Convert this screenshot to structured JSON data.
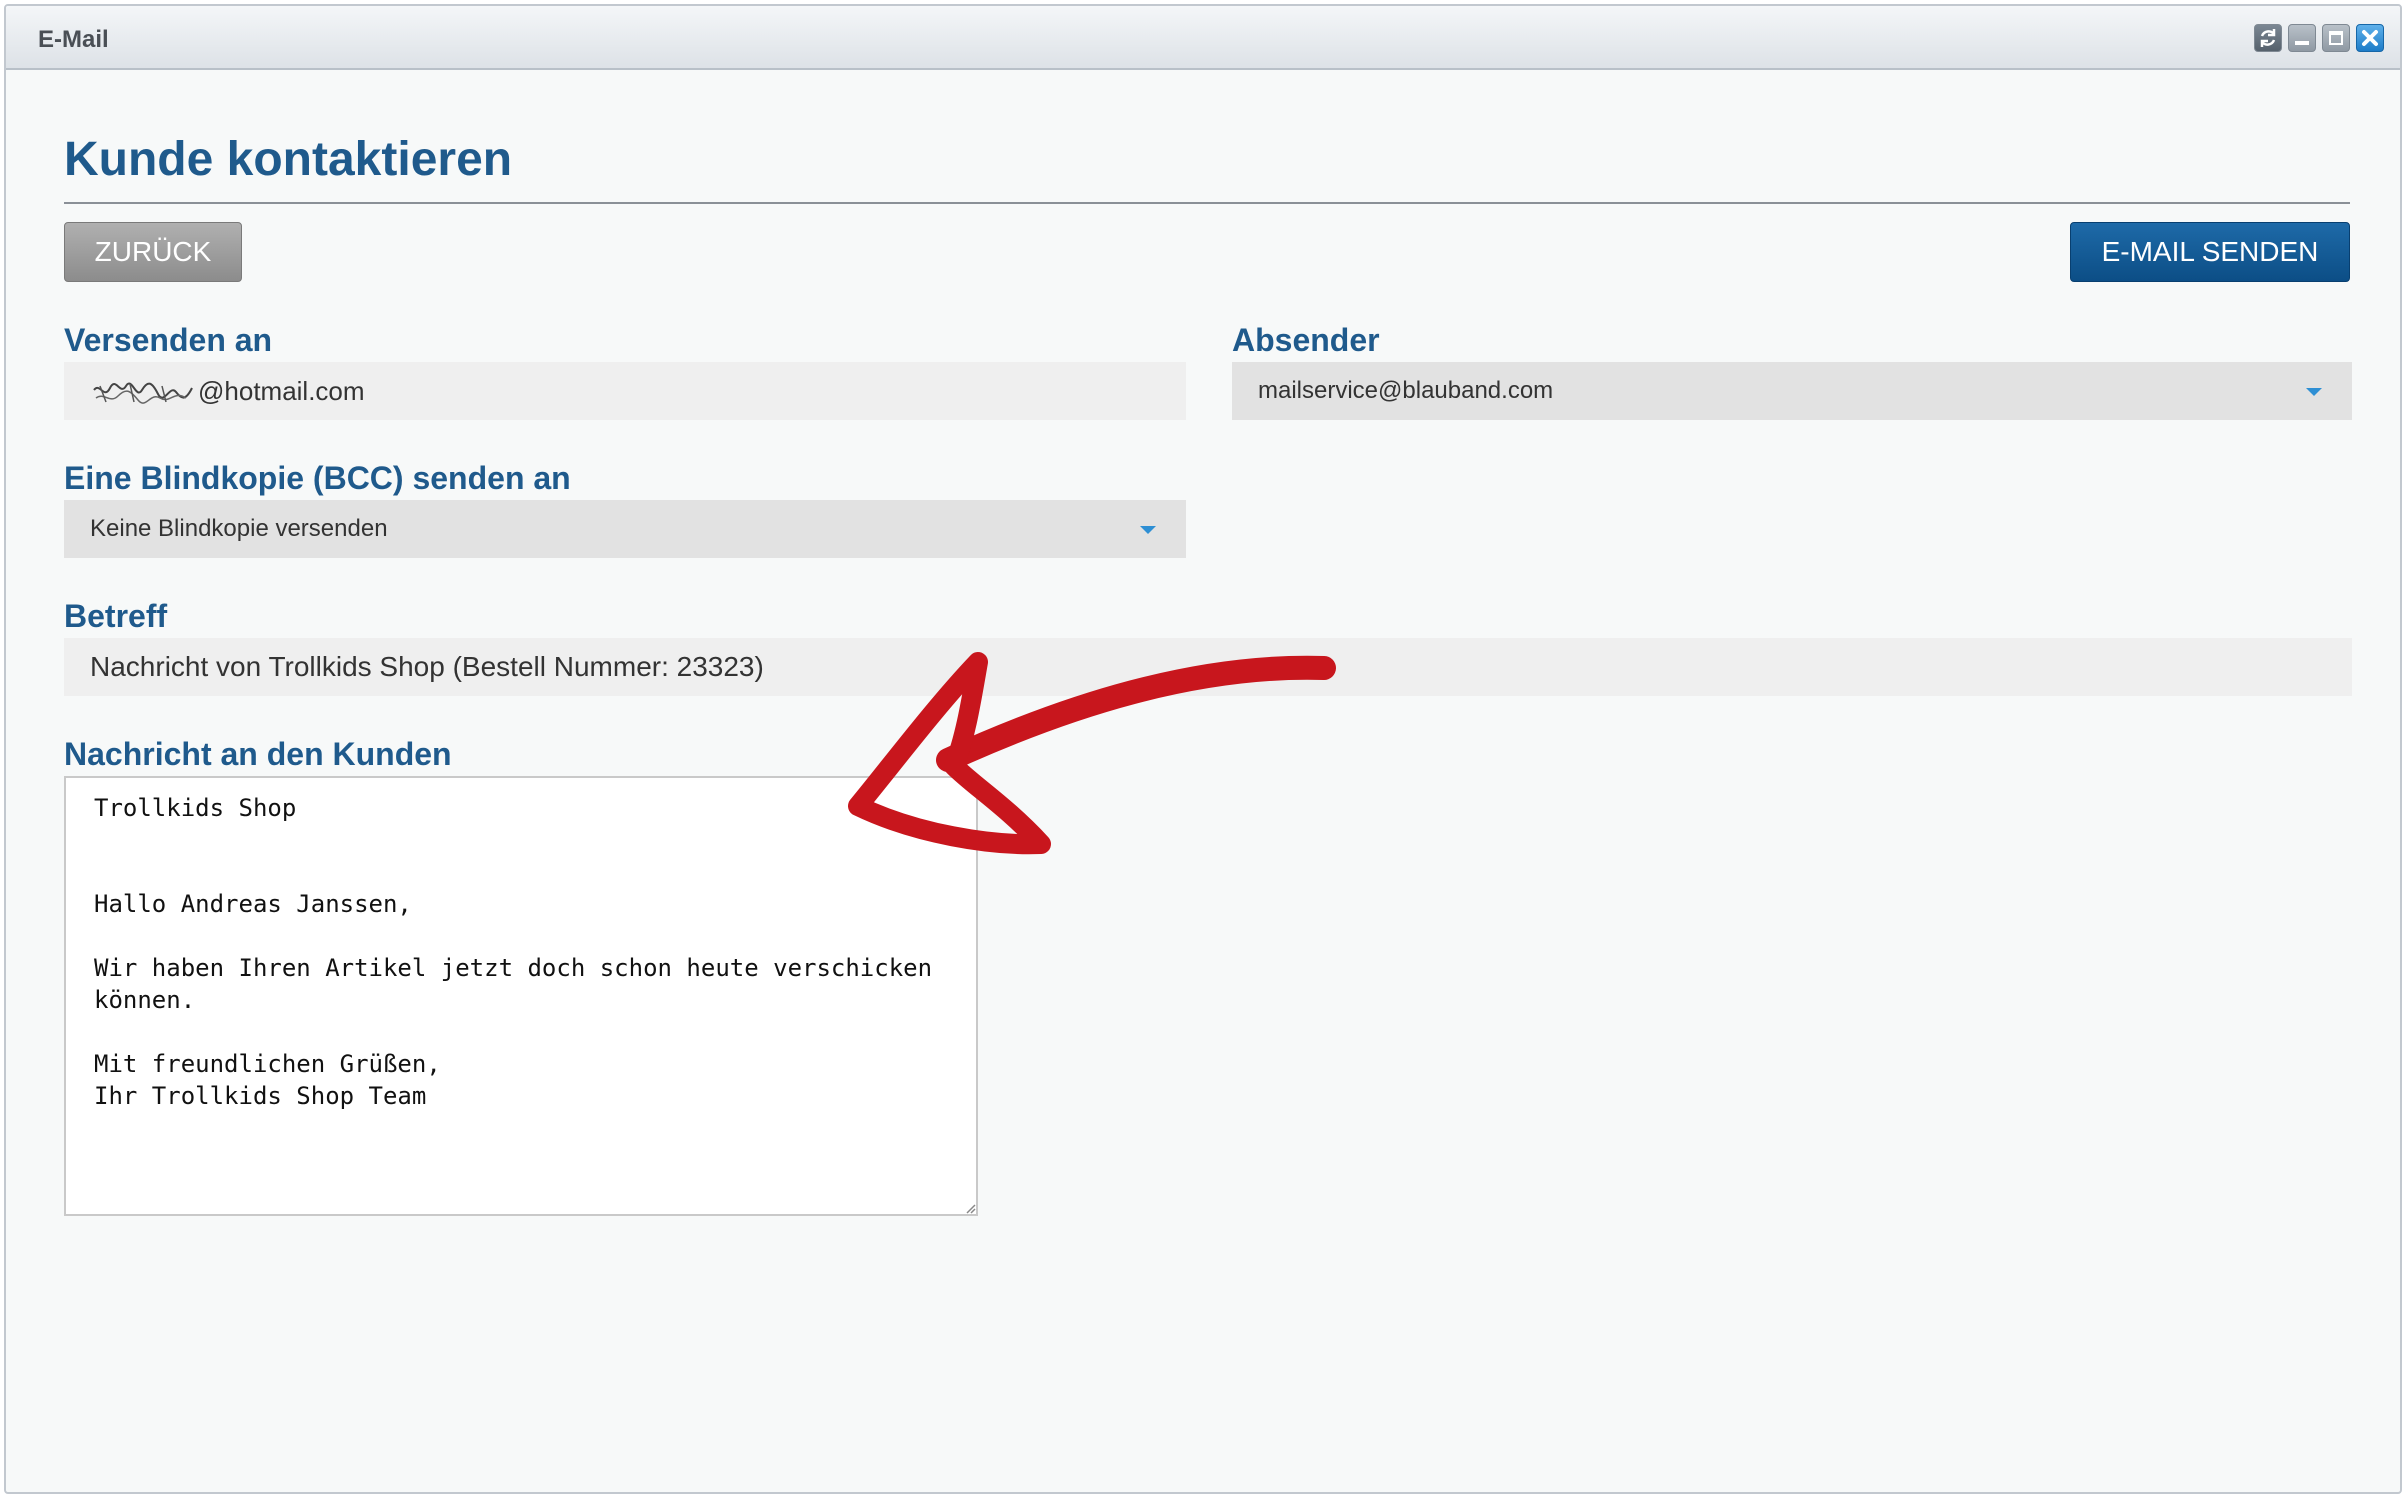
{
  "window": {
    "title": "E-Mail"
  },
  "page": {
    "title": "Kunde kontaktieren"
  },
  "toolbar": {
    "back_label": "ZURÜCK",
    "send_label": "E-MAIL SENDEN"
  },
  "recipient": {
    "label": "Versenden an",
    "value_suffix": "@hotmail.com"
  },
  "sender": {
    "label": "Absender",
    "selected": "mailservice@blauband.com"
  },
  "bcc": {
    "label": "Eine Blindkopie (BCC) senden an",
    "selected": "Keine Blindkopie versenden"
  },
  "subject": {
    "label": "Betreff",
    "value": "Nachricht von Trollkids Shop (Bestell Nummer: 23323)"
  },
  "message": {
    "label": "Nachricht an den Kunden",
    "body": "Trollkids Shop\n\n\nHallo Andreas Janssen,\n\nWir haben Ihren Artikel jetzt doch schon heute verschicken können.\n\nMit freundlichen Grüßen,\nIhr Trollkids Shop Team"
  },
  "colors": {
    "accent": "#1f5a8c",
    "primary_button": "#0c4e86",
    "secondary_button": "#8c8c8c",
    "annotation_arrow": "#c8161d"
  },
  "icons": {
    "refresh": "refresh-icon",
    "minimize": "minimize-icon",
    "maximize": "maximize-icon",
    "close": "close-icon",
    "dropdown": "chevron-down-icon",
    "annotation": "arrow-annotation"
  }
}
